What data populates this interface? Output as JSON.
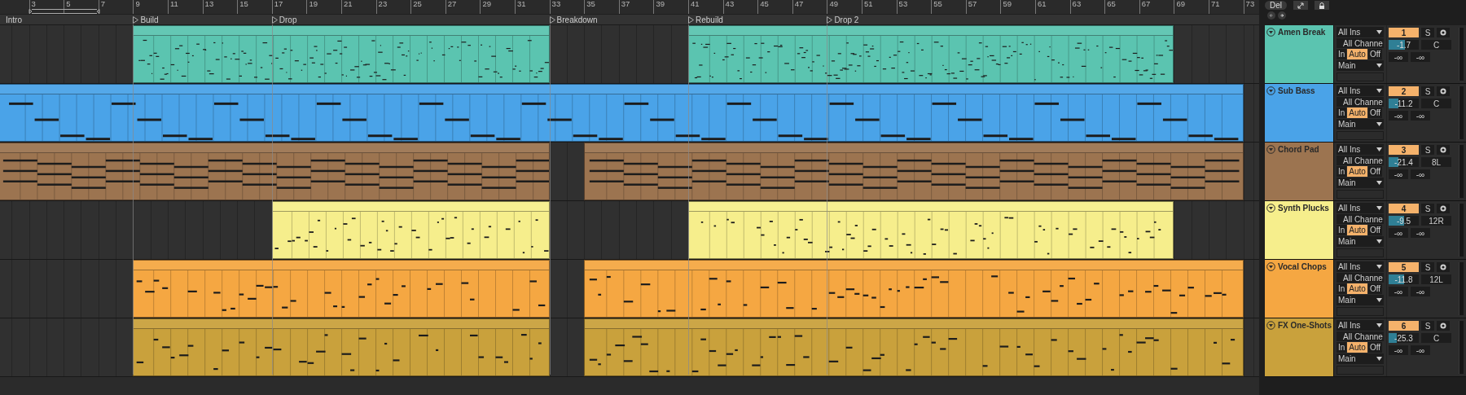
{
  "ruler": {
    "bars": [
      "3",
      "5",
      "7",
      "9",
      "11",
      "13",
      "15",
      "17",
      "19",
      "21",
      "23",
      "25",
      "27",
      "29",
      "31",
      "33",
      "35",
      "37",
      "39",
      "41",
      "43",
      "45",
      "47",
      "49",
      "51",
      "53",
      "55",
      "57",
      "59",
      "61",
      "63",
      "65",
      "67",
      "69",
      "71",
      "73"
    ]
  },
  "locators": [
    {
      "name": "Intro"
    },
    {
      "name": "Build"
    },
    {
      "name": "Drop"
    },
    {
      "name": "Breakdown"
    },
    {
      "name": "Rebuild"
    },
    {
      "name": "Drop 2"
    }
  ],
  "toolbar": {
    "delete_button": "Del"
  },
  "tracks": [
    {
      "name": "Amen Break",
      "color": "#5bc4b0",
      "input": "All Ins",
      "channel": "All Channe",
      "monitor": [
        {
          "label": "In",
          "selected": false
        },
        {
          "label": "Auto",
          "selected": true
        },
        {
          "label": "Off",
          "selected": false
        }
      ],
      "output": "Main",
      "number": "1",
      "active": true,
      "solo_label": "S",
      "solo": false,
      "armed": false,
      "volume": {
        "reading": "-1.7",
        "level": 0.55
      },
      "pan": "C",
      "sends": [
        "-∞",
        "-∞"
      ]
    },
    {
      "name": "Sub Bass",
      "color": "#4aa3e8",
      "input": "All Ins",
      "channel": "All Channe",
      "monitor": [
        {
          "label": "In",
          "selected": false
        },
        {
          "label": "Auto",
          "selected": true
        },
        {
          "label": "Off",
          "selected": false
        }
      ],
      "output": "Main",
      "number": "2",
      "active": true,
      "solo_label": "S",
      "solo": false,
      "armed": false,
      "volume": {
        "reading": "-11.2",
        "level": 0.32
      },
      "pan": "C",
      "sends": [
        "-∞",
        "-∞"
      ]
    },
    {
      "name": "Chord Pad",
      "color": "#9c7450",
      "input": "All Ins",
      "channel": "All Channe",
      "monitor": [
        {
          "label": "In",
          "selected": false
        },
        {
          "label": "Auto",
          "selected": true
        },
        {
          "label": "Off",
          "selected": false
        }
      ],
      "output": "Main",
      "number": "3",
      "active": true,
      "solo_label": "S",
      "solo": false,
      "armed": false,
      "volume": {
        "reading": "-21.4",
        "level": 0.33
      },
      "pan": "8L",
      "sends": [
        "-∞",
        "-∞"
      ]
    },
    {
      "name": "Synth Plucks",
      "color": "#f6ee8c",
      "input": "All Ins",
      "channel": "All Channe",
      "monitor": [
        {
          "label": "In",
          "selected": false
        },
        {
          "label": "Auto",
          "selected": true
        },
        {
          "label": "Off",
          "selected": false
        }
      ],
      "output": "Main",
      "number": "4",
      "active": true,
      "solo_label": "S",
      "solo": false,
      "armed": false,
      "volume": {
        "reading": "-9.5",
        "level": 0.5
      },
      "pan": "12R",
      "sends": [
        "-∞",
        "-∞"
      ]
    },
    {
      "name": "Vocal Chops",
      "color": "#f5a742",
      "input": "All Ins",
      "channel": "All Channe",
      "monitor": [
        {
          "label": "In",
          "selected": false
        },
        {
          "label": "Auto",
          "selected": true
        },
        {
          "label": "Off",
          "selected": false
        }
      ],
      "output": "Main",
      "number": "5",
      "active": true,
      "solo_label": "S",
      "solo": false,
      "armed": false,
      "volume": {
        "reading": "-11.8",
        "level": 0.5
      },
      "pan": "12L",
      "sends": [
        "-∞",
        "-∞"
      ]
    },
    {
      "name": "FX One-Shots",
      "color": "#c9a13c",
      "input": "All Ins",
      "channel": "All Channe",
      "monitor": [
        {
          "label": "In",
          "selected": false
        },
        {
          "label": "Auto",
          "selected": true
        },
        {
          "label": "Off",
          "selected": false
        }
      ],
      "output": "Main",
      "number": "6",
      "active": true,
      "solo_label": "S",
      "solo": false,
      "armed": false,
      "volume": {
        "reading": "-25.3",
        "level": 0.28
      },
      "pan": "C",
      "sends": [
        "-∞",
        "-∞"
      ]
    }
  ]
}
